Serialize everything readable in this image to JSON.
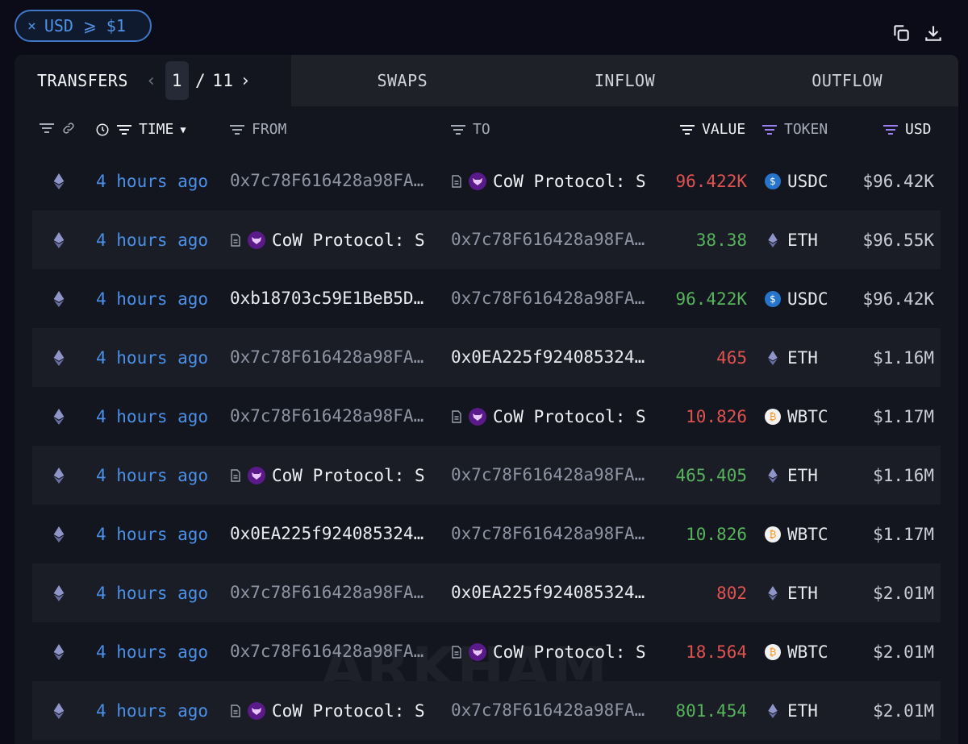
{
  "filter": {
    "close": "×",
    "label": "USD ⩾ $1"
  },
  "tabs": {
    "transfers": "TRANSFERS",
    "page_current": "1",
    "page_sep": "/",
    "page_total": "11",
    "swaps": "SWAPS",
    "inflow": "INFLOW",
    "outflow": "OUTFLOW"
  },
  "columns": {
    "time": "TIME",
    "from": "FROM",
    "to": "TO",
    "value": "VALUE",
    "token": "TOKEN",
    "usd": "USD"
  },
  "rows": [
    {
      "time": "4 hours ago",
      "from": {
        "type": "addr",
        "text": "0x7c78F616428a98FA..."
      },
      "to": {
        "type": "entity",
        "text": "CoW Protocol: S"
      },
      "value": "96.422K",
      "dir": "neg",
      "token": "USDC",
      "token_icon": "usdc-icon",
      "usd": "$96.42K"
    },
    {
      "time": "4 hours ago",
      "from": {
        "type": "entity",
        "text": "CoW Protocol: S"
      },
      "to": {
        "type": "addr",
        "text": "0x7c78F616428a98FA..."
      },
      "value": "38.38",
      "dir": "pos",
      "token": "ETH",
      "token_icon": "eth-icon",
      "usd": "$96.55K"
    },
    {
      "time": "4 hours ago",
      "from": {
        "type": "addr-bright",
        "text": "0xb18703c59E1BeB5D..."
      },
      "to": {
        "type": "addr",
        "text": "0x7c78F616428a98FA..."
      },
      "value": "96.422K",
      "dir": "pos",
      "token": "USDC",
      "token_icon": "usdc-icon",
      "usd": "$96.42K"
    },
    {
      "time": "4 hours ago",
      "from": {
        "type": "addr",
        "text": "0x7c78F616428a98FA..."
      },
      "to": {
        "type": "addr-bright",
        "text": "0x0EA225f924085324..."
      },
      "value": "465",
      "dir": "neg",
      "token": "ETH",
      "token_icon": "eth-icon",
      "usd": "$1.16M"
    },
    {
      "time": "4 hours ago",
      "from": {
        "type": "addr",
        "text": "0x7c78F616428a98FA..."
      },
      "to": {
        "type": "entity",
        "text": "CoW Protocol: S"
      },
      "value": "10.826",
      "dir": "neg",
      "token": "WBTC",
      "token_icon": "wbtc-icon",
      "usd": "$1.17M"
    },
    {
      "time": "4 hours ago",
      "from": {
        "type": "entity",
        "text": "CoW Protocol: S"
      },
      "to": {
        "type": "addr",
        "text": "0x7c78F616428a98FA..."
      },
      "value": "465.405",
      "dir": "pos",
      "token": "ETH",
      "token_icon": "eth-icon",
      "usd": "$1.16M"
    },
    {
      "time": "4 hours ago",
      "from": {
        "type": "addr-bright",
        "text": "0x0EA225f924085324..."
      },
      "to": {
        "type": "addr",
        "text": "0x7c78F616428a98FA..."
      },
      "value": "10.826",
      "dir": "pos",
      "token": "WBTC",
      "token_icon": "wbtc-icon",
      "usd": "$1.17M"
    },
    {
      "time": "4 hours ago",
      "from": {
        "type": "addr",
        "text": "0x7c78F616428a98FA..."
      },
      "to": {
        "type": "addr-bright",
        "text": "0x0EA225f924085324..."
      },
      "value": "802",
      "dir": "neg",
      "token": "ETH",
      "token_icon": "eth-icon",
      "usd": "$2.01M"
    },
    {
      "time": "4 hours ago",
      "from": {
        "type": "addr",
        "text": "0x7c78F616428a98FA..."
      },
      "to": {
        "type": "entity",
        "text": "CoW Protocol: S"
      },
      "value": "18.564",
      "dir": "neg",
      "token": "WBTC",
      "token_icon": "wbtc-icon",
      "usd": "$2.01M"
    },
    {
      "time": "4 hours ago",
      "from": {
        "type": "entity",
        "text": "CoW Protocol: S"
      },
      "to": {
        "type": "addr",
        "text": "0x7c78F616428a98FA..."
      },
      "value": "801.454",
      "dir": "pos",
      "token": "ETH",
      "token_icon": "eth-icon",
      "usd": "$2.01M"
    }
  ],
  "watermark": "ARKHAM",
  "colors": {
    "accent": "#4a90e8",
    "positive": "#56b35b",
    "negative": "#e0524f",
    "filter_active": "#9a7ff0"
  }
}
